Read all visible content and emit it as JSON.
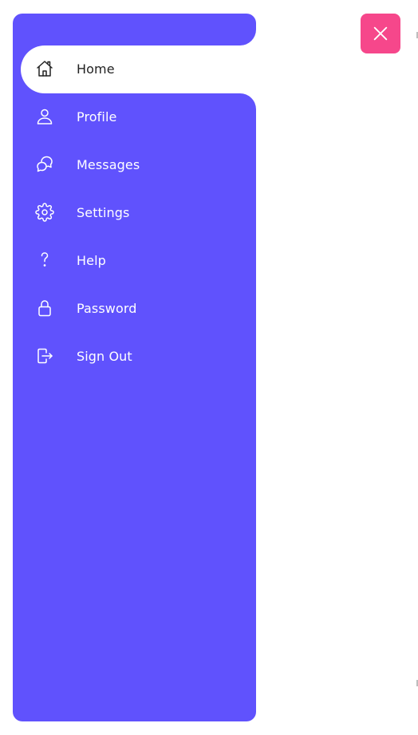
{
  "sidebar": {
    "background": "#6052fd",
    "active_background": "#ffffff",
    "items": [
      {
        "label": "Home",
        "icon": "home-icon",
        "active": true
      },
      {
        "label": "Profile",
        "icon": "user-icon",
        "active": false
      },
      {
        "label": "Messages",
        "icon": "chat-icon",
        "active": false
      },
      {
        "label": "Settings",
        "icon": "gear-icon",
        "active": false
      },
      {
        "label": "Help",
        "icon": "question-icon",
        "active": false
      },
      {
        "label": "Password",
        "icon": "lock-icon",
        "active": false
      },
      {
        "label": "Sign Out",
        "icon": "sign-out-icon",
        "active": false
      }
    ]
  },
  "close_button": {
    "icon": "close-icon",
    "color": "#f6478b"
  }
}
